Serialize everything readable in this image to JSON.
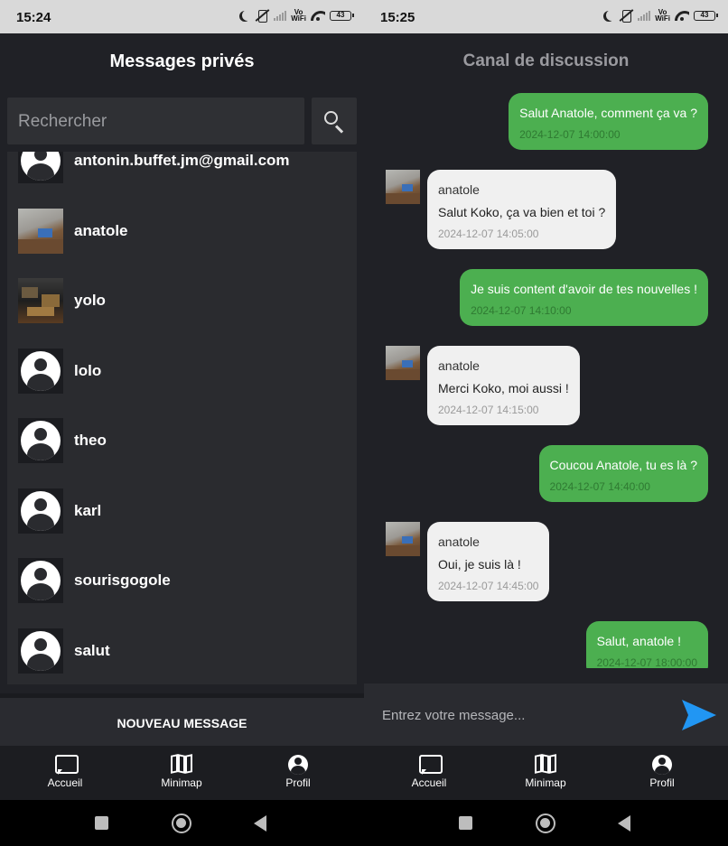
{
  "left": {
    "status": {
      "time": "15:24",
      "battery": "43",
      "vowifi_top": "Vo",
      "vowifi_bottom": "WiFi"
    },
    "title": "Messages privés",
    "search": {
      "placeholder": "Rechercher",
      "icon": "search-icon"
    },
    "contacts": [
      {
        "name": "antonin.buffet.jm@gmail.com",
        "avatar": "default-avatar-icon"
      },
      {
        "name": "anatole",
        "avatar": "photo"
      },
      {
        "name": "yolo",
        "avatar": "photo"
      },
      {
        "name": "lolo",
        "avatar": "default-avatar-icon"
      },
      {
        "name": "theo",
        "avatar": "default-avatar-icon"
      },
      {
        "name": "karl",
        "avatar": "default-avatar-icon"
      },
      {
        "name": "sourisgogole",
        "avatar": "default-avatar-icon"
      },
      {
        "name": "salut",
        "avatar": "default-avatar-icon"
      }
    ],
    "new_message_label": "NOUVEAU MESSAGE",
    "nav": [
      {
        "label": "Accueil",
        "icon": "chat-icon"
      },
      {
        "label": "Minimap",
        "icon": "map-icon"
      },
      {
        "label": "Profil",
        "icon": "profile-icon"
      }
    ]
  },
  "right": {
    "status": {
      "time": "15:25",
      "battery": "43",
      "vowifi_top": "Vo",
      "vowifi_bottom": "WiFi"
    },
    "title": "Canal de discussion",
    "messages": [
      {
        "direction": "out",
        "text": "Salut Anatole, comment ça va ?",
        "timestamp": "2024-12-07 14:00:00"
      },
      {
        "direction": "in",
        "sender": "anatole",
        "text": "Salut Koko, ça va bien et toi ?",
        "timestamp": "2024-12-07 14:05:00"
      },
      {
        "direction": "out",
        "text": "Je suis content d'avoir de tes nouvelles !",
        "timestamp": "2024-12-07 14:10:00"
      },
      {
        "direction": "in",
        "sender": "anatole",
        "text": "Merci Koko, moi aussi !",
        "timestamp": "2024-12-07 14:15:00"
      },
      {
        "direction": "out",
        "text": "Coucou Anatole, tu es là ?",
        "timestamp": "2024-12-07 14:40:00"
      },
      {
        "direction": "in",
        "sender": "anatole",
        "text": "Oui, je suis là !",
        "timestamp": "2024-12-07 14:45:00"
      },
      {
        "direction": "out",
        "text": "Salut, anatole !",
        "timestamp": "2024-12-07 18:00:00"
      }
    ],
    "composer": {
      "placeholder": "Entrez votre message...",
      "send_icon": "send-icon",
      "accent": "#2196f3"
    },
    "nav": [
      {
        "label": "Accueil",
        "icon": "chat-icon"
      },
      {
        "label": "Minimap",
        "icon": "map-icon"
      },
      {
        "label": "Profil",
        "icon": "profile-icon"
      }
    ]
  },
  "colors": {
    "background": "#202126",
    "outgoing_bubble": "#4caf50",
    "incoming_bubble": "#f0f0f0"
  }
}
